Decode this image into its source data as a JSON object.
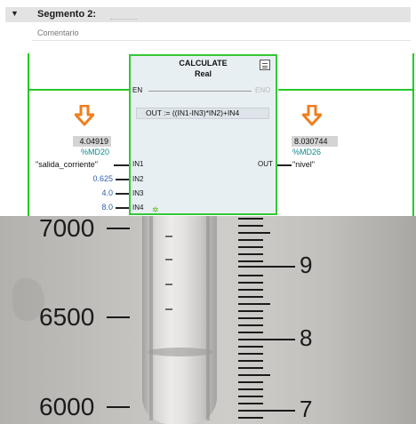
{
  "segment": {
    "toggle_icon": "triangle-down-icon",
    "title": "Segmento 2:",
    "comment": "Comentario"
  },
  "block": {
    "name": "CALCULATE",
    "type": "Real",
    "en": "EN",
    "eno": "ENO",
    "formula": "OUT :=   ((IN1-IN3)*IN2)+IN4",
    "inputs": [
      "IN1",
      "IN2",
      "IN3",
      "IN4"
    ],
    "output": "OUT"
  },
  "left_monitor": {
    "value": "4.04919",
    "address": "%MD20",
    "tag": "\"salida_corriente\""
  },
  "right_monitor": {
    "value": "8.030744",
    "address": "%MD26",
    "tag": "\"nivel\""
  },
  "constants": {
    "in2": "0.625",
    "in3": "4.0",
    "in4": "8.0"
  },
  "colors": {
    "energized_wire": "#26c826",
    "block_border": "#34c834",
    "monitor_arrow": "#f07d1e",
    "address_text": "#0f8a8a",
    "constant_text": "#2d5fae"
  },
  "photo": {
    "left_scale": [
      "7000",
      "6500",
      "6000"
    ],
    "right_scale": [
      "9",
      "8",
      "7"
    ]
  }
}
